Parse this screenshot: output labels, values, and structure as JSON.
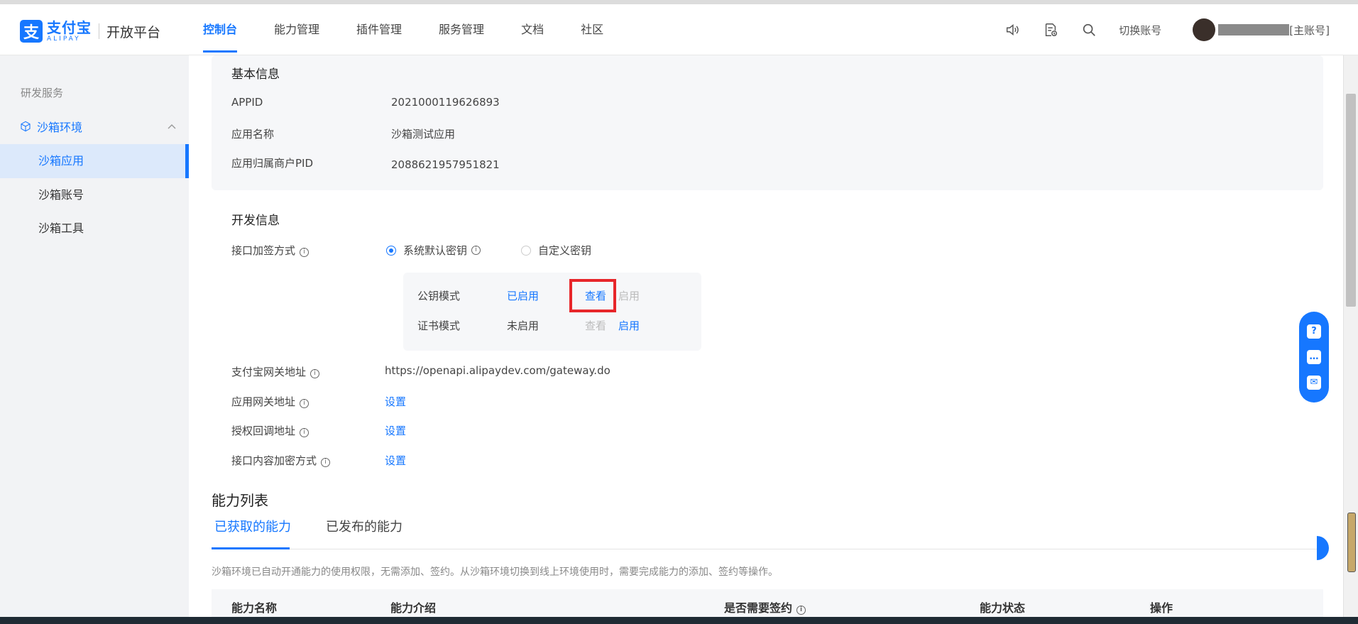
{
  "brand": {
    "cn": "支付宝",
    "en": "ALIPAY",
    "platform": "开放平台",
    "mark": "支"
  },
  "nav": [
    {
      "label": "控制台",
      "active": true
    },
    {
      "label": "能力管理"
    },
    {
      "label": "插件管理"
    },
    {
      "label": "服务管理"
    },
    {
      "label": "文档"
    },
    {
      "label": "社区"
    }
  ],
  "header": {
    "switch_account": "切换账号",
    "user_suffix": "[主账号]"
  },
  "sidebar": {
    "group": "研发服务",
    "parent": "沙箱环境",
    "items": [
      {
        "label": "沙箱应用",
        "active": true
      },
      {
        "label": "沙箱账号"
      },
      {
        "label": "沙箱工具"
      }
    ]
  },
  "basic": {
    "title": "基本信息",
    "appid_label": "APPID",
    "appid": "2021000119626893",
    "appname_label": "应用名称",
    "appname": "沙箱测试应用",
    "pid_label": "应用归属商户PID",
    "pid": "2088621957951821"
  },
  "dev": {
    "title": "开发信息",
    "sign_label": "接口加签方式",
    "radio_default": "系统默认密钥",
    "radio_custom": "自定义密钥",
    "pubkey_mode": "公钥模式",
    "pubkey_status": "已启用",
    "pubkey_view": "查看",
    "pubkey_enable": "启用",
    "cert_mode": "证书模式",
    "cert_status": "未启用",
    "cert_view": "查看",
    "cert_enable": "启用",
    "gateway_label": "支付宝网关地址",
    "gateway_value": "https://openapi.alipaydev.com/gateway.do",
    "app_gateway_label": "应用网关地址",
    "auth_callback_label": "授权回调地址",
    "encrypt_label": "接口内容加密方式",
    "set": "设置"
  },
  "abilities": {
    "title": "能力列表",
    "tab_obtained": "已获取的能力",
    "tab_published": "已发布的能力",
    "note": "沙箱环境已自动开通能力的使用权限，无需添加、签约。从沙箱环境切换到线上环境使用时，需要完成能力的添加、签约等操作。",
    "columns": [
      "能力名称",
      "能力介绍",
      "是否需要签约",
      "能力状态",
      "操作"
    ]
  },
  "float_help": {
    "icon_question": "?",
    "icon_chat": "…",
    "icon_mail": "✉"
  }
}
